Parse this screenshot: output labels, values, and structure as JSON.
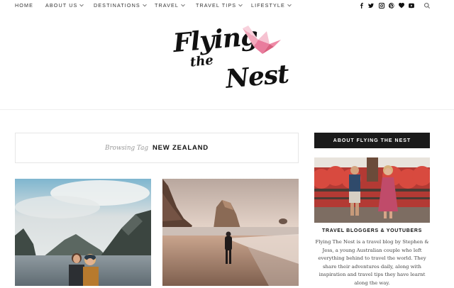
{
  "nav": {
    "items": [
      {
        "label": "HOME",
        "dropdown": false
      },
      {
        "label": "ABOUT US",
        "dropdown": true
      },
      {
        "label": "DESTINATIONS",
        "dropdown": true
      },
      {
        "label": "TRAVEL",
        "dropdown": true
      },
      {
        "label": "TRAVEL TIPS",
        "dropdown": true
      },
      {
        "label": "LIFESTYLE",
        "dropdown": true
      }
    ],
    "social_icons": [
      "facebook-icon",
      "twitter-icon",
      "instagram-icon",
      "pinterest-icon",
      "heart-icon",
      "youtube-icon",
      "search-icon"
    ]
  },
  "logo": {
    "line1": "Flying",
    "line2": "the",
    "line3": "Nest",
    "accent_color": "#ee8aa6"
  },
  "browsing": {
    "prefix": "Browsing Tag",
    "tag": "NEW ZEALAND"
  },
  "sidebar": {
    "widget_title": "ABOUT FLYING THE NEST",
    "subtitle": "TRAVEL BLOGGERS & YOUTUBERS",
    "description": "Flying The Nest is a travel blog by Stephen & Jess, a young Australian couple who left everything behind to travel the world. They share their adventures daily, along with inspiration and travel tips they have learnt along the way."
  },
  "colors": {
    "text": "#222222",
    "widget_bg": "#1a1a1a",
    "border": "#e6e6e6"
  }
}
